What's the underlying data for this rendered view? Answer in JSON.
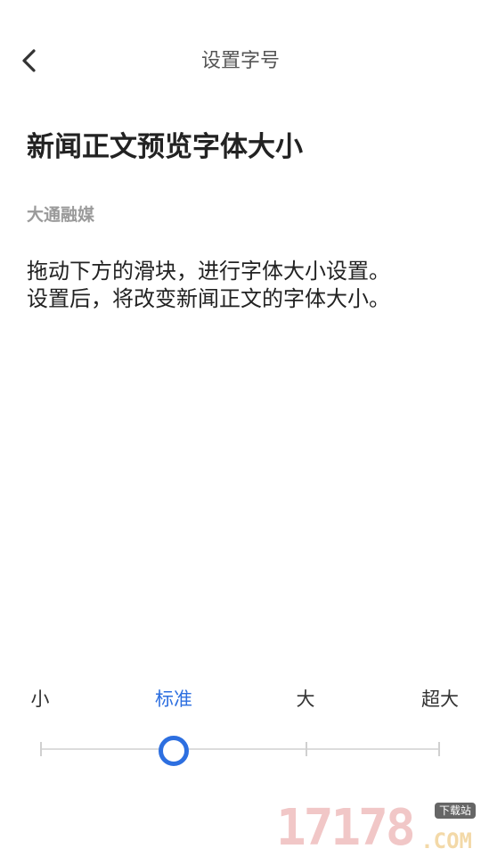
{
  "header": {
    "title": "设置字号",
    "back_icon": "chevron-left-icon"
  },
  "preview": {
    "title": "新闻正文预览字体大小",
    "source": "大通融媒",
    "body_lines": [
      "拖动下方的滑块，进行字体大小设置。",
      "设置后，将改变新闻正文的字体大小。"
    ]
  },
  "font_size_slider": {
    "options": [
      "小",
      "标准",
      "大",
      "超大"
    ],
    "selected": "标准",
    "selected_index": 1,
    "accent_color": "#2d6fe0"
  },
  "watermark": {
    "numbers": "17178",
    "domain": ".COM",
    "badge": "下载站"
  }
}
